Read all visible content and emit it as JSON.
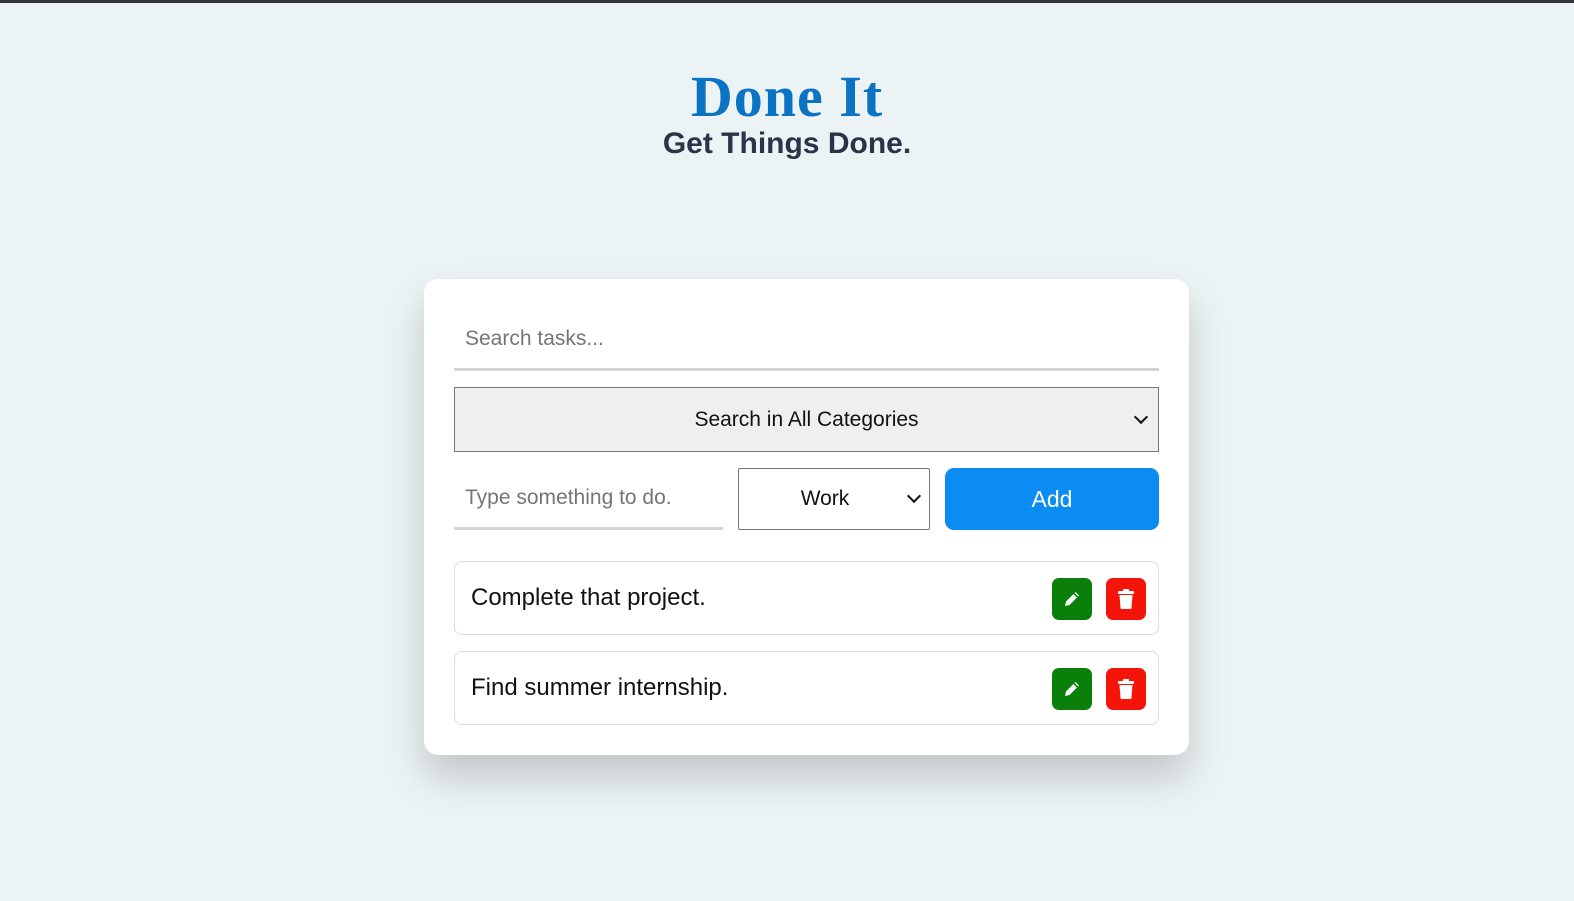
{
  "app": {
    "title": "Done It",
    "subtitle": "Get Things Done."
  },
  "search": {
    "placeholder": "Search tasks...",
    "value": ""
  },
  "category_filter": {
    "selected": "Search in All Categories"
  },
  "new_task": {
    "placeholder": "Type something to do.",
    "value": "",
    "category_selected": "Work",
    "add_label": "Add"
  },
  "tasks": [
    {
      "text": "Complete that project.",
      "edit_icon": "pencil-icon",
      "delete_icon": "trash-icon"
    },
    {
      "text": "Find summer internship.",
      "edit_icon": "pencil-icon",
      "delete_icon": "trash-icon"
    }
  ],
  "colors": {
    "title": "#0a73c4",
    "subtitle": "#2c3348",
    "add_button": "#0a8cf2",
    "edit_button": "#0a7f0a",
    "delete_button": "#f5140a",
    "background": "#ecf3f4"
  }
}
